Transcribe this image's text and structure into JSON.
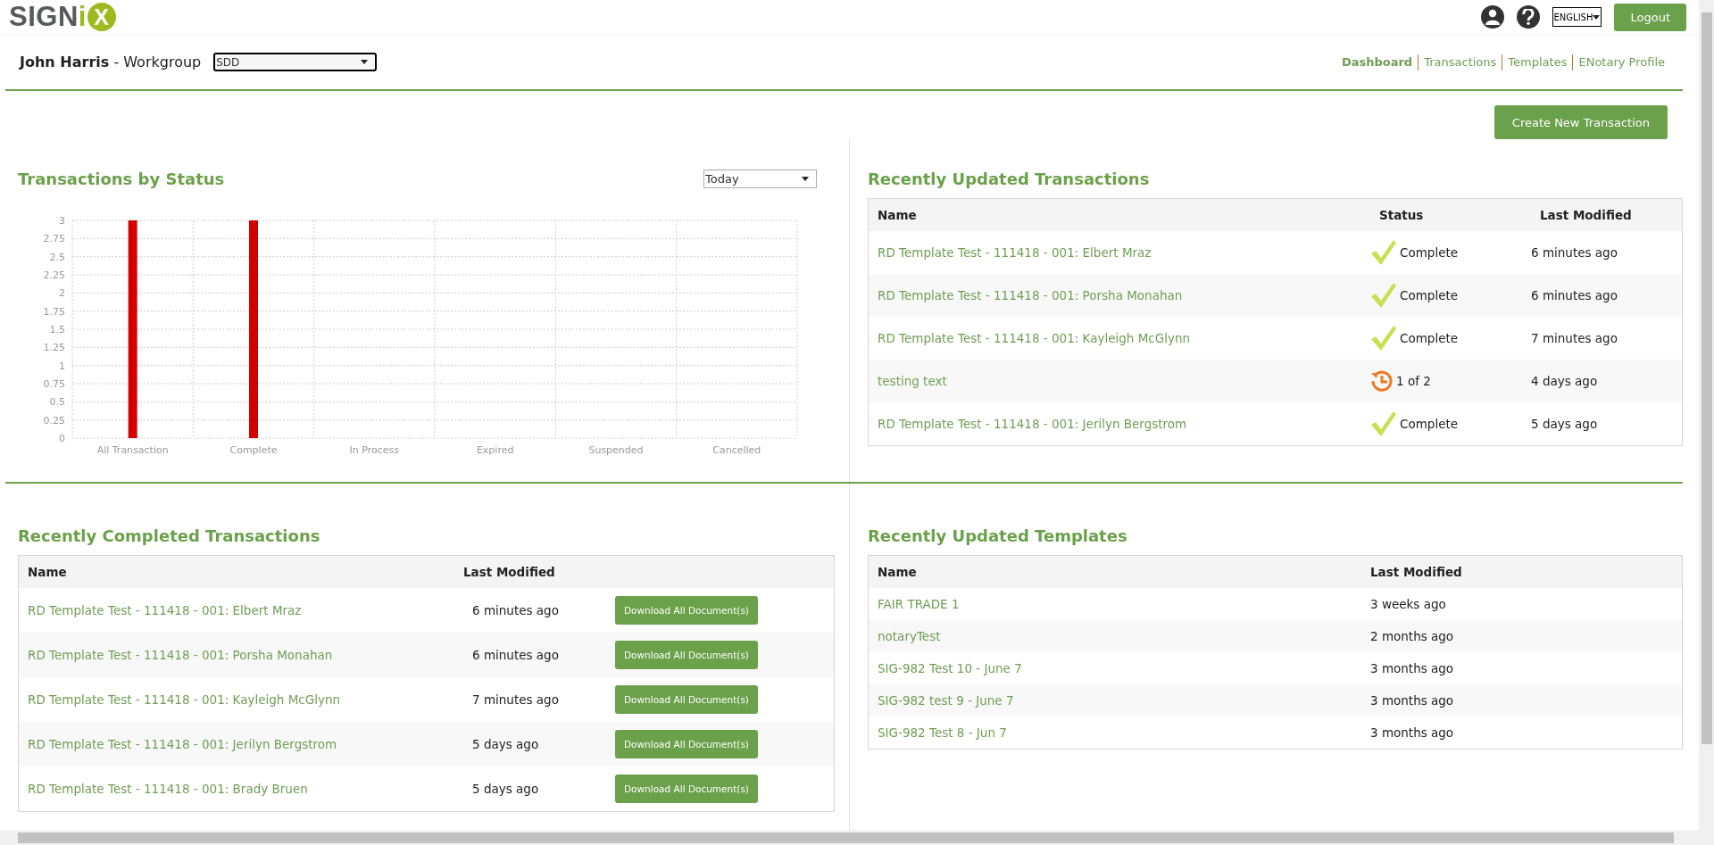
{
  "header": {
    "logo": {
      "text": "SIGN",
      "accent": "i",
      "badge": "X"
    },
    "language": "ENGLISH",
    "logout": "Logout"
  },
  "user": {
    "name": "John Harris",
    "suffix": "- Workgroup",
    "workgroup": "SDD"
  },
  "nav": [
    {
      "label": "Dashboard",
      "selected": true
    },
    {
      "label": "Transactions",
      "selected": false
    },
    {
      "label": "Templates",
      "selected": false
    },
    {
      "label": "ENotary Profile",
      "selected": false
    }
  ],
  "create_button": "Create New Transaction",
  "status_chart": {
    "title": "Transactions by Status",
    "period": "Today",
    "chart_data": {
      "type": "bar",
      "categories": [
        "All Transaction",
        "Complete",
        "In Process",
        "Expired",
        "Suspended",
        "Cancelled"
      ],
      "series": [
        {
          "color": "#d40000",
          "values": [
            3,
            3,
            0,
            0,
            0,
            0
          ]
        }
      ],
      "grid": true,
      "ylim": [
        0,
        3
      ],
      "yticks": [
        0,
        0.25,
        0.5,
        0.75,
        1,
        1.25,
        1.5,
        1.75,
        2,
        2.25,
        2.5,
        2.75,
        3
      ]
    }
  },
  "recent_transactions": {
    "title": "Recently Updated Transactions",
    "columns": [
      "Name",
      "Status",
      "Last Modified"
    ],
    "rows": [
      {
        "name": "RD Template Test - 111418 - 001: Elbert Mraz",
        "status": {
          "kind": "complete",
          "label": "Complete"
        },
        "modified": "6 minutes ago"
      },
      {
        "name": "RD Template Test - 111418 - 001: Porsha Monahan",
        "status": {
          "kind": "complete",
          "label": "Complete"
        },
        "modified": "6 minutes ago"
      },
      {
        "name": "RD Template Test - 111418 - 001: Kayleigh McGlynn",
        "status": {
          "kind": "complete",
          "label": "Complete"
        },
        "modified": "7 minutes ago"
      },
      {
        "name": "testing text",
        "status": {
          "kind": "pending",
          "label": "1 of 2"
        },
        "modified": "4 days ago"
      },
      {
        "name": "RD Template Test - 111418 - 001: Jerilyn Bergstrom",
        "status": {
          "kind": "complete",
          "label": "Complete"
        },
        "modified": "5 days ago"
      }
    ]
  },
  "completed_transactions": {
    "title": "Recently Completed Transactions",
    "columns": [
      "Name",
      "Last Modified"
    ],
    "rows": [
      {
        "name": "RD Template Test - 111418 - 001: Elbert Mraz",
        "modified": "6 minutes ago",
        "action": "Download All Document(s)"
      },
      {
        "name": "RD Template Test - 111418 - 001: Porsha Monahan",
        "modified": "6 minutes ago",
        "action": "Download All Document(s)"
      },
      {
        "name": "RD Template Test - 111418 - 001: Kayleigh McGlynn",
        "modified": "7 minutes ago",
        "action": "Download All Document(s)"
      },
      {
        "name": "RD Template Test - 111418 - 001: Jerilyn Bergstrom",
        "modified": "5 days ago",
        "action": "Download All Document(s)"
      },
      {
        "name": "RD Template Test - 111418 - 001: Brady Bruen",
        "modified": "5 days ago",
        "action": "Download All Document(s)"
      }
    ]
  },
  "recent_templates": {
    "title": "Recently Updated Templates",
    "columns": [
      "Name",
      "Last Modified"
    ],
    "rows": [
      {
        "name": "FAIR TRADE 1",
        "modified": "3 weeks ago"
      },
      {
        "name": "notaryTest",
        "modified": "2 months ago"
      },
      {
        "name": "SIG-982 Test 10 - June 7",
        "modified": "3 months ago"
      },
      {
        "name": "SIG-982 test 9 - June 7",
        "modified": "3 months ago"
      },
      {
        "name": "SIG-982 Test 8 - Jun 7",
        "modified": "3 months ago"
      }
    ]
  }
}
